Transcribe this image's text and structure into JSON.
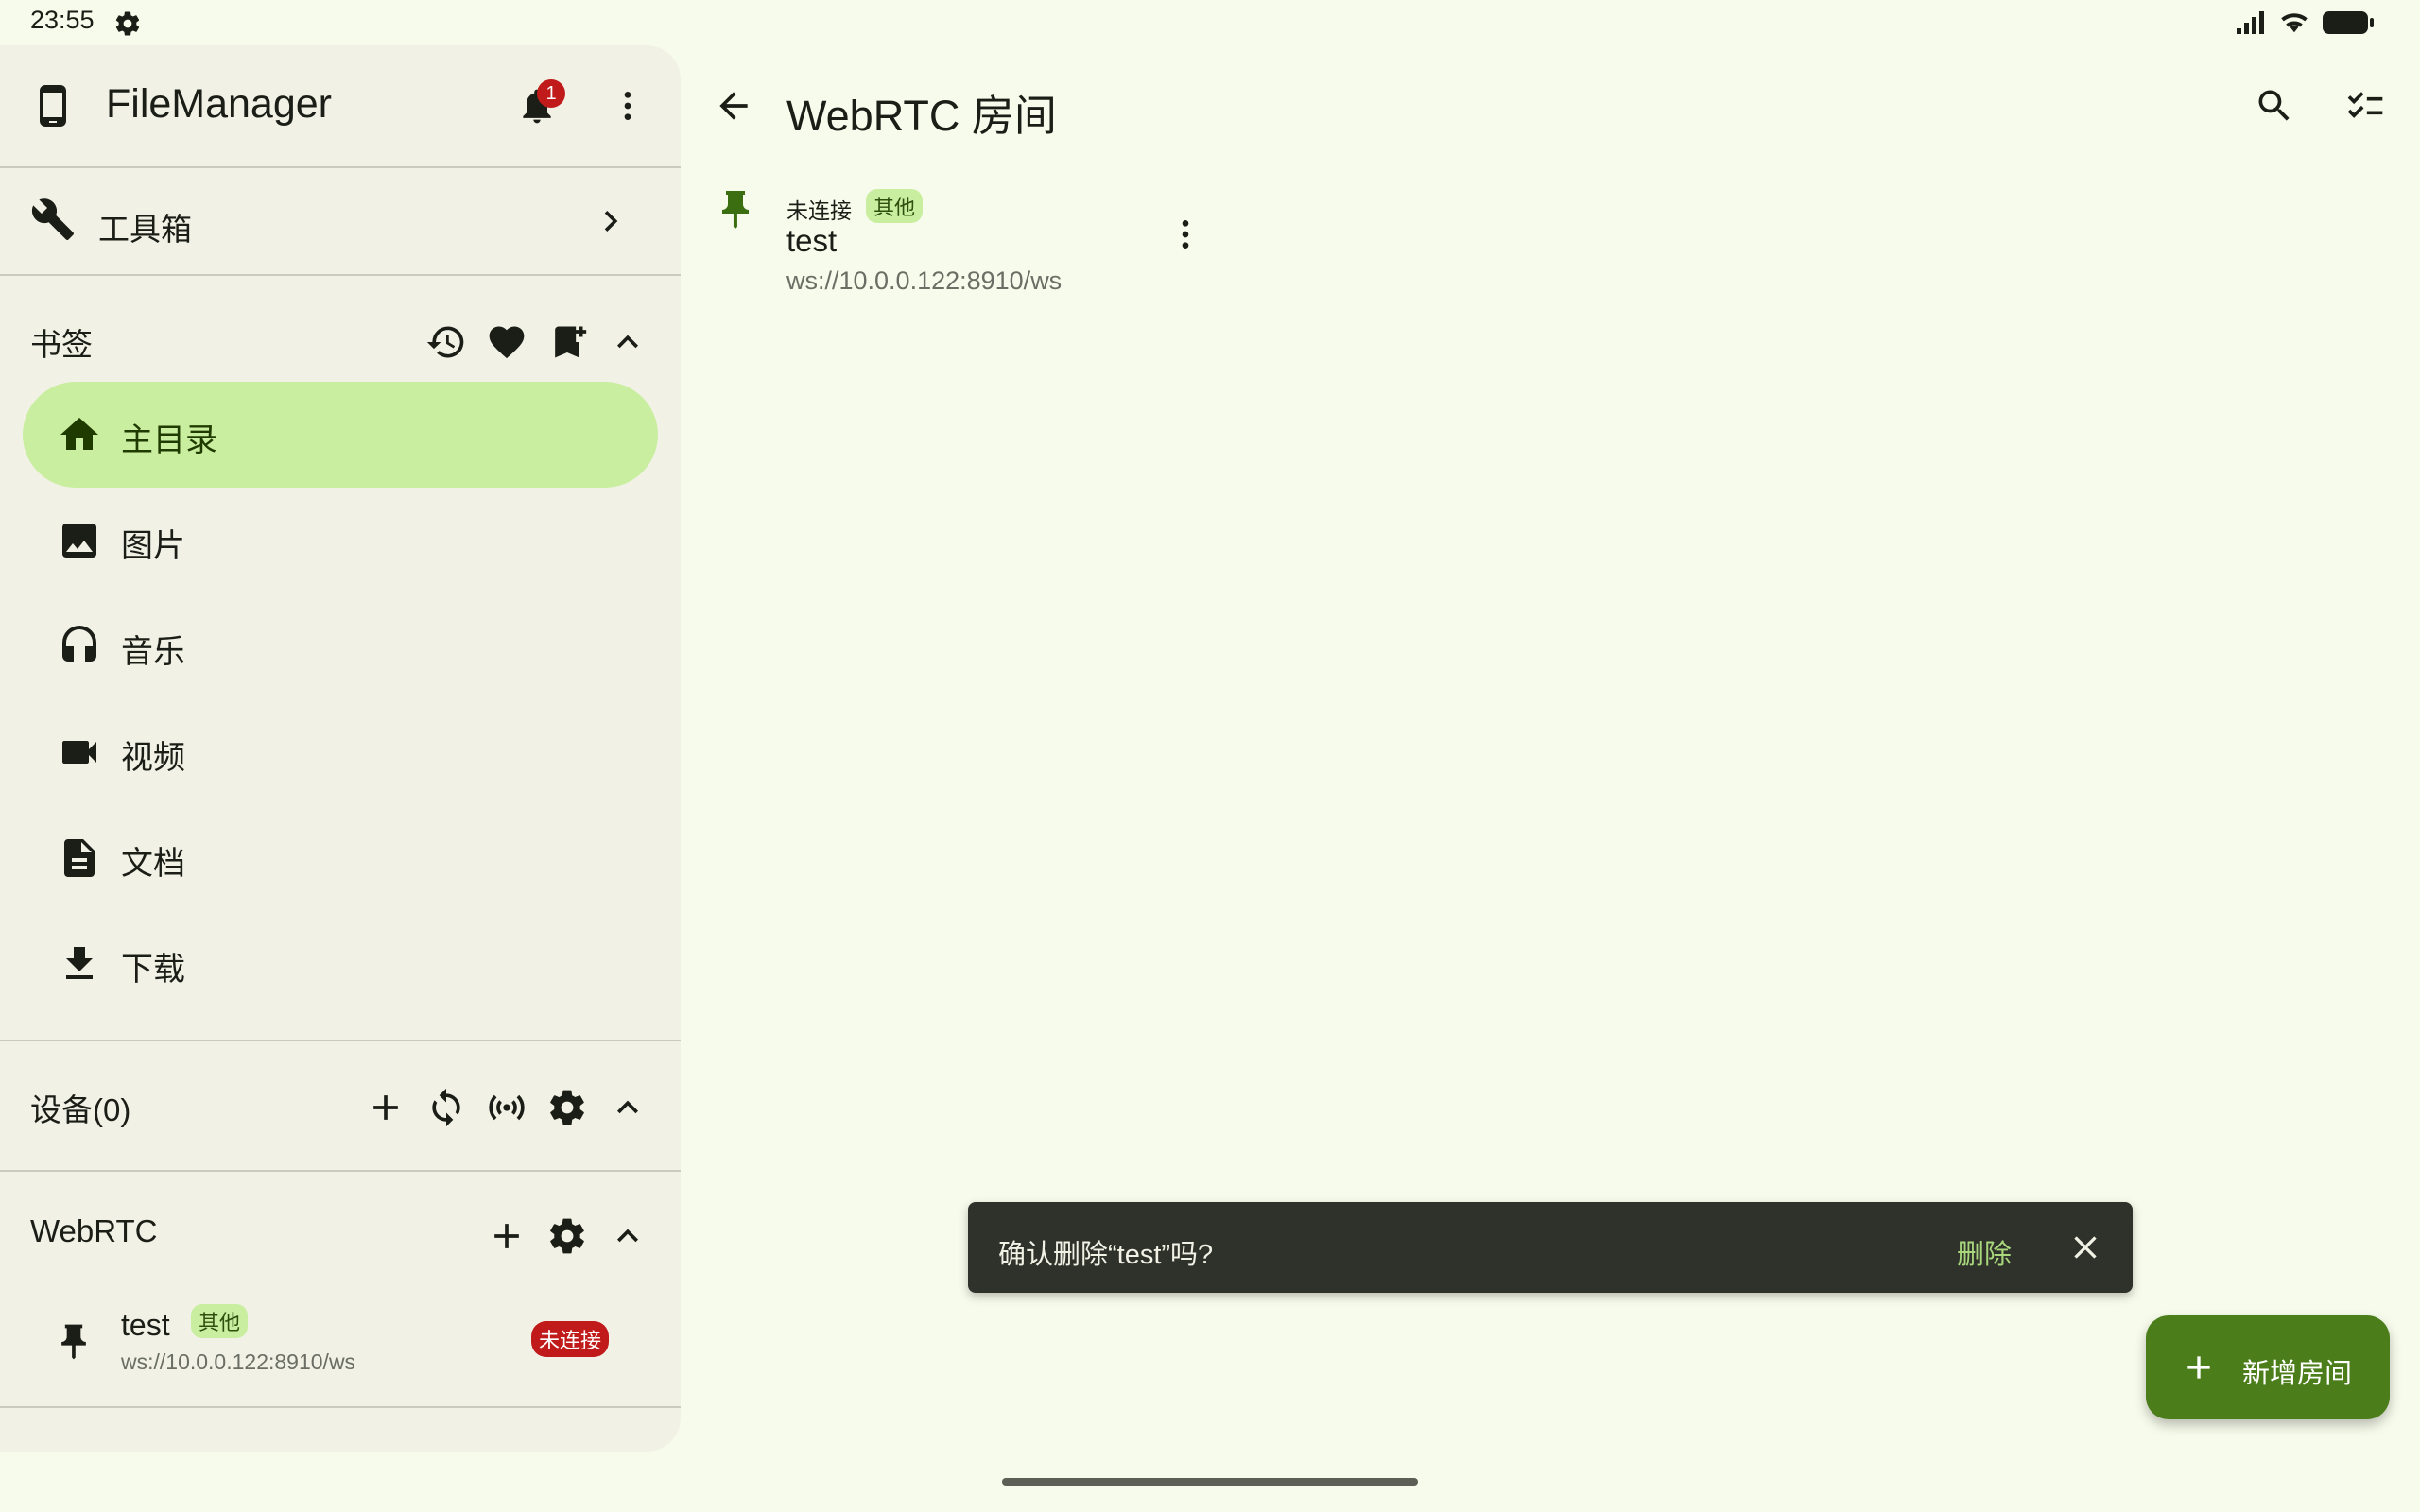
{
  "status_bar": {
    "time": "23:55"
  },
  "drawer": {
    "app_title": "FileManager",
    "notification_count": "1",
    "toolbox_label": "工具箱",
    "bookmarks": {
      "header": "书签",
      "items": [
        {
          "label": "主目录",
          "icon": "home-icon",
          "active": true
        },
        {
          "label": "图片",
          "icon": "image-icon"
        },
        {
          "label": "音乐",
          "icon": "headphones-icon"
        },
        {
          "label": "视频",
          "icon": "videocam-icon"
        },
        {
          "label": "文档",
          "icon": "document-icon"
        },
        {
          "label": "下载",
          "icon": "download-icon"
        }
      ]
    },
    "devices": {
      "header": "设备(0)"
    },
    "webrtc": {
      "header": "WebRTC",
      "room": {
        "name": "test",
        "tag": "其他",
        "url": "ws://10.0.0.122:8910/ws",
        "status": "未连接"
      }
    }
  },
  "main": {
    "title": "WebRTC 房间",
    "room": {
      "status": "未连接",
      "tag": "其他",
      "name": "test",
      "url": "ws://10.0.0.122:8910/ws"
    }
  },
  "snackbar": {
    "message": "确认删除“test”吗?",
    "action": "删除"
  },
  "fab": {
    "label": "新增房间"
  },
  "colors": {
    "background": "#f7fbeb",
    "drawer": "#f1f2e5",
    "accent_container": "#c9eea0",
    "fab": "#4b7e1a",
    "badge_red": "#c01a1a",
    "snackbar": "#2f312b",
    "snackbar_action": "#a8d77c"
  }
}
